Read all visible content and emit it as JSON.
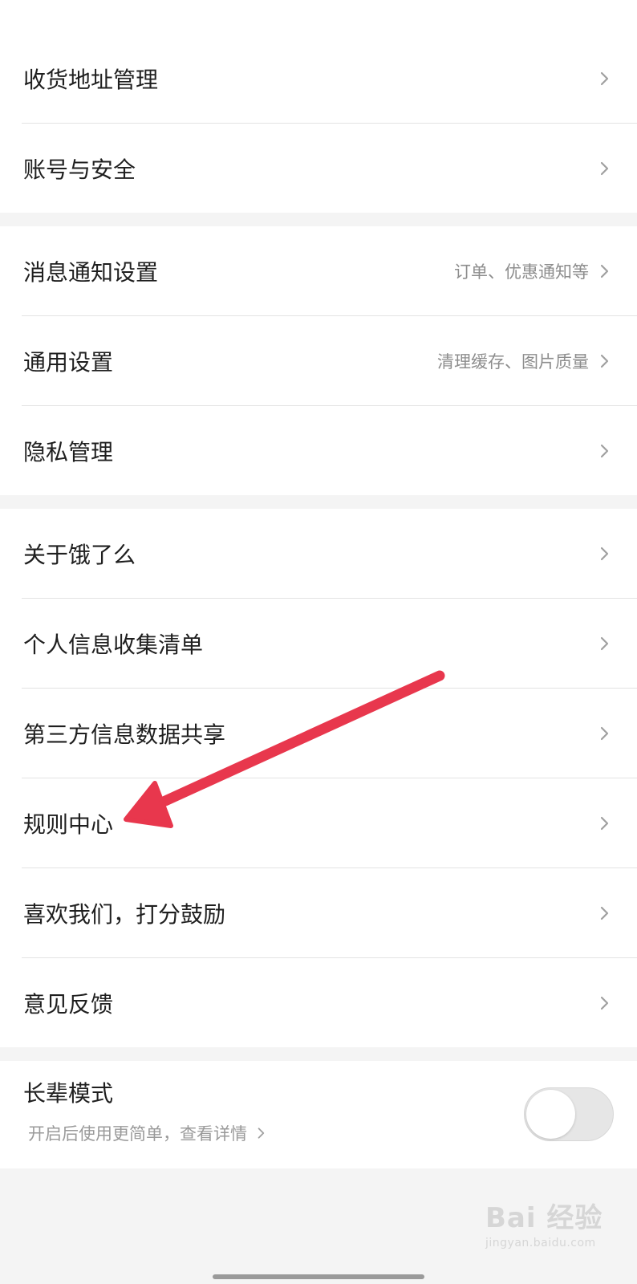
{
  "groups": [
    {
      "items": [
        {
          "label": "收货地址管理",
          "detail": ""
        },
        {
          "label": "账号与安全",
          "detail": ""
        }
      ]
    },
    {
      "items": [
        {
          "label": "消息通知设置",
          "detail": "订单、优惠通知等"
        },
        {
          "label": "通用设置",
          "detail": "清理缓存、图片质量"
        },
        {
          "label": "隐私管理",
          "detail": ""
        }
      ]
    },
    {
      "items": [
        {
          "label": "关于饿了么",
          "detail": ""
        },
        {
          "label": "个人信息收集清单",
          "detail": ""
        },
        {
          "label": "第三方信息数据共享",
          "detail": ""
        },
        {
          "label": "规则中心",
          "detail": ""
        },
        {
          "label": "喜欢我们，打分鼓励",
          "detail": ""
        },
        {
          "label": "意见反馈",
          "detail": ""
        }
      ]
    }
  ],
  "elder_mode": {
    "title": "长辈模式",
    "subtitle": "开启后使用更简单，查看详情",
    "enabled": false
  },
  "watermark": {
    "main": "Bai  经验",
    "sub": "jingyan.baidu.com"
  },
  "colors": {
    "arrow": "#e8374d",
    "background": "#f4f4f4",
    "row": "#ffffff"
  },
  "icons": {
    "chevron": "chevron-right-icon",
    "toggle": "toggle-switch",
    "annotation": "red-arrow-annotation"
  }
}
